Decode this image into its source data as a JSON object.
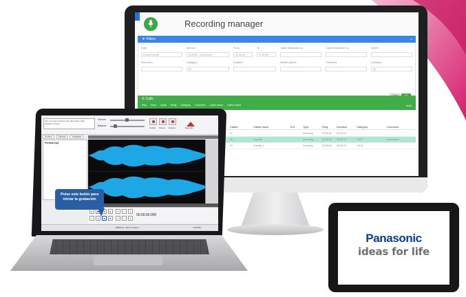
{
  "recording_manager": {
    "title": "Recording manager",
    "filters": {
      "header": "Filters",
      "fields": [
        {
          "label": "Date",
          "value": "Current month"
        },
        {
          "label": "Interval",
          "value": "11/2016 - 11/11/2016"
        },
        {
          "label": "From",
          "value": "11:00:00"
        },
        {
          "label": "To",
          "value": "11:59:59"
        },
        {
          "label": "Caller telephone no.",
          "value": ""
        },
        {
          "label": "Called telephone no.",
          "value": ""
        },
        {
          "label": "Name",
          "value": ""
        },
        {
          "label": "Extension",
          "value": ""
        },
        {
          "label": "Category",
          "value": "All"
        },
        {
          "label": "Duration",
          "value": ""
        },
        {
          "label": "Modify Queue",
          "value": ""
        },
        {
          "label": "Comment",
          "value": ""
        },
        {
          "label": "Call type",
          "value": "All"
        }
      ],
      "clear_label": "Clear",
      "ok_label": "OK"
    },
    "calls": {
      "header": "Calls",
      "actions": [
        "Play",
        "Save",
        "Audit",
        "Verify",
        "Category",
        "Comment",
        "Caller name",
        "Called name"
      ],
      "right_action": "Audit",
      "columns": [
        "Called",
        "Called name",
        "Ext.",
        "Type",
        "Ring",
        "Duration",
        "Category",
        "Comment"
      ],
      "rows": [
        [
          "22",
          "",
          "",
          "Incoming",
          "00:00:00",
          "00:00:03",
          "",
          ""
        ],
        [
          "20",
          "Dorothy",
          "",
          "Incoming",
          "00:00:00",
          "00:00:15",
          "CX15",
          "Comment 1"
        ],
        [
          "20",
          "Dorothy 2",
          "",
          "Incoming",
          "00:00:00",
          "00:00:03",
          "CX15",
          ""
        ]
      ]
    }
  },
  "audio_editor": {
    "file_label": "File: mic test sound 01.wav (Decoded: High Definition Audio)",
    "volume_label": "Volume",
    "balance_label": "Balance",
    "buttons": [
      "Grabar",
      "Pausa",
      "Detener",
      "Exportar"
    ],
    "tabs": [
      "Archivo",
      "Efectos",
      "Visualizar"
    ],
    "sidebar_item": "Portada.mp3",
    "time": "00:00:00.000",
    "status": "48000 Hz, 16 bit, Estéreo",
    "status_right": "4:18.000",
    "tooltip": "Pulse este botón para iniciar la grabación"
  },
  "tablet": {
    "brand": "Panasonic",
    "tagline": "ideas for life"
  },
  "colors": {
    "filters_blue": "#3a86e8",
    "calls_green": "#41ad49",
    "highlight_row": "#aee6d4",
    "tooltip_blue": "#2a5ea4",
    "waveform_blue": "#1ea7e6",
    "panasonic_blue": "#0b3c94"
  }
}
